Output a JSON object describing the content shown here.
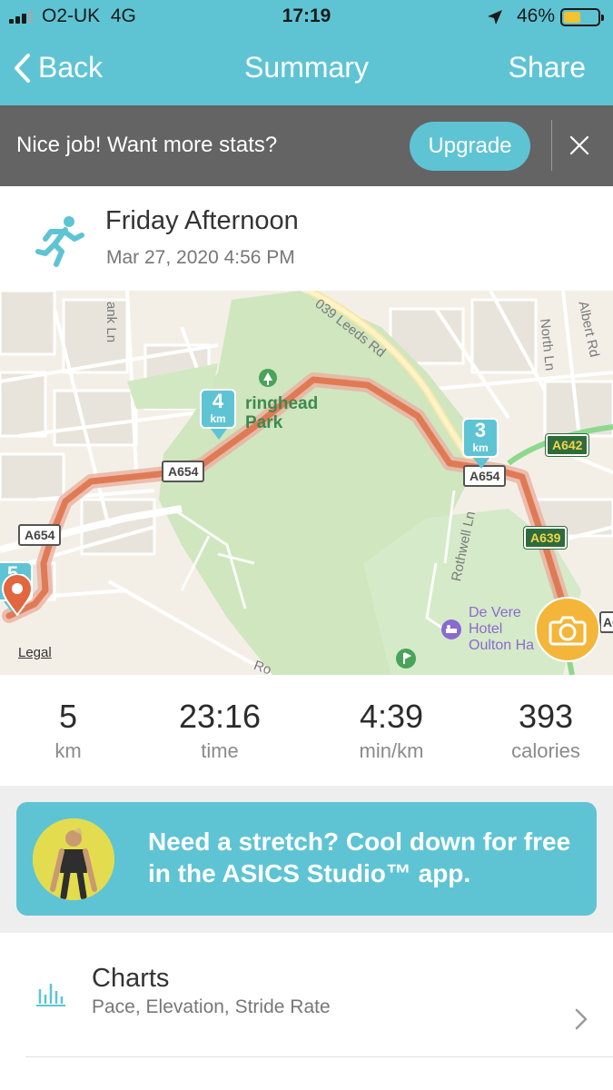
{
  "status_bar": {
    "carrier": "O2-UK",
    "network": "4G",
    "time": "17:19",
    "battery_percent": "46%",
    "battery_level": 0.46
  },
  "nav": {
    "back_label": "Back",
    "title": "Summary",
    "share_label": "Share"
  },
  "banner": {
    "message": "Nice job! Want more stats?",
    "upgrade_label": "Upgrade"
  },
  "activity": {
    "name": "Friday Afternoon",
    "datetime": "Mar 27, 2020 4:56 PM",
    "icon": "runner-icon"
  },
  "map": {
    "street_labels": [
      "ank Ln",
      "039 Leeds Rd",
      "North Ln",
      "Albert Rd",
      "Rothwell Ln",
      "Ro"
    ],
    "park_name_line1": "ringhead",
    "park_name_line2": "Park",
    "hotel_line1": "De Vere",
    "hotel_line2": "Hotel",
    "hotel_line3": "Oulton Ha",
    "road_shields": [
      "A654",
      "A654",
      "A654",
      "A642",
      "A639",
      "A6"
    ],
    "km_markers": [
      {
        "number": "4",
        "unit": "km"
      },
      {
        "number": "3",
        "unit": "km"
      },
      {
        "number": "5",
        "unit": ""
      }
    ],
    "legal_label": "Legal",
    "route_color": "#e07a55"
  },
  "stats": [
    {
      "value": "5",
      "label": "km"
    },
    {
      "value": "23:16",
      "label": "time"
    },
    {
      "value": "4:39",
      "label": "min/km"
    },
    {
      "value": "393",
      "label": "calories"
    }
  ],
  "promo": {
    "text": "Need a stretch? Cool down for free in the ASICS Studio™ app."
  },
  "charts_row": {
    "title": "Charts",
    "subtitle": "Pace, Elevation, Stride Rate"
  },
  "colors": {
    "accent": "#5ec4d4",
    "banner": "#646464",
    "camera": "#f3b63a"
  }
}
